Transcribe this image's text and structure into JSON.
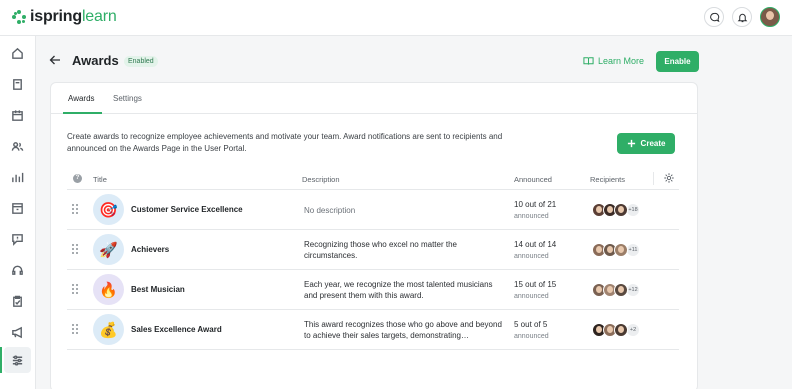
{
  "app": {
    "logo_bold": "ispring",
    "logo_accent": "learn"
  },
  "header": {
    "title": "Awards",
    "status": "Enabled",
    "learn_more": "Learn More",
    "enable_label": "Enable"
  },
  "tabs": [
    {
      "label": "Awards",
      "active": true
    },
    {
      "label": "Settings",
      "active": false
    }
  ],
  "intro": "Create awards to recognize employee achievements and motivate your team. Award notifications are sent to recipients and announced on the Awards Page in the User Portal.",
  "create_label": "Create",
  "table": {
    "headers": {
      "title": "Title",
      "description": "Description",
      "announced": "Announced",
      "recipients": "Recipients"
    },
    "rows": [
      {
        "icon": "🎯",
        "icon_bg": "#dcebf7",
        "title": "Customer Service Excellence",
        "description": "No description",
        "announced": "10 out of 21",
        "announced_sub": "announced",
        "more": "+18",
        "avatar_colors": [
          "#5b3f35",
          "#3b2b26",
          "#4d3a33"
        ]
      },
      {
        "icon": "🚀",
        "icon_bg": "#dcebf7",
        "title": "Achievers",
        "description": "Recognizing those who excel no matter the circumstances.",
        "announced": "14 out of 14",
        "announced_sub": "announced",
        "more": "+11",
        "avatar_colors": [
          "#8a6b58",
          "#6e5a4c",
          "#9b7e68"
        ]
      },
      {
        "icon": "🔥",
        "icon_bg": "#e6e2f6",
        "title": "Best Musician",
        "description": "Each year, we recognize the most talented musicians and present them with this award.",
        "announced": "15 out of 15",
        "announced_sub": "announced",
        "more": "+12",
        "avatar_colors": [
          "#7a6152",
          "#a08370",
          "#5a4a40"
        ]
      },
      {
        "icon": "💰",
        "icon_bg": "#dcebf7",
        "title": "Sales Excellence Award",
        "description": "This award recognizes those who go above and beyond to achieve their sales targets, demonstrating…",
        "announced": "5 out of 5",
        "announced_sub": "announced",
        "more": "+2",
        "avatar_colors": [
          "#2e241f",
          "#8b6d5a",
          "#4a3a32"
        ]
      }
    ]
  },
  "colors": {
    "accent": "#2fae67"
  }
}
